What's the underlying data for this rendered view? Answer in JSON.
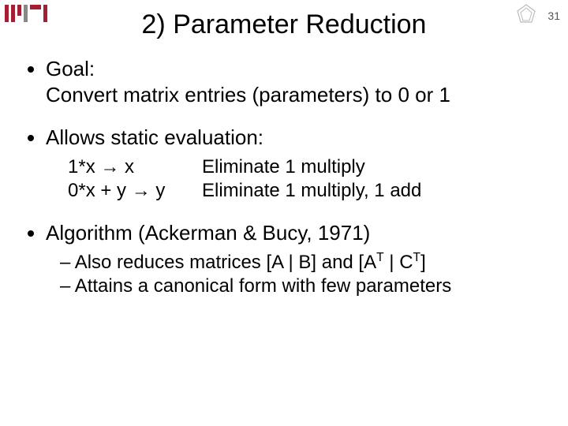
{
  "page_number": "31",
  "title": "2) Parameter Reduction",
  "bullets": {
    "goal_label": "Goal:",
    "goal_text": "Convert matrix entries (parameters) to 0 or 1",
    "static_eval": "Allows static evaluation:",
    "ex1_lhs": "1*x → x",
    "ex1_rhs": "Eliminate 1 multiply",
    "ex2_lhs": "0*x + y → y",
    "ex2_rhs": "Eliminate 1 multiply, 1 add",
    "algo": "Algorithm (Ackerman & Bucy, 1971)",
    "sub1_pre": "Also reduces matrices [A | B] and [A",
    "sub1_mid": " | C",
    "sub1_post": "]",
    "sup": "T",
    "sub2": "Attains a canonical form with few parameters"
  },
  "logos": {
    "mit": "mit-logo",
    "csail": "csail-logo"
  }
}
